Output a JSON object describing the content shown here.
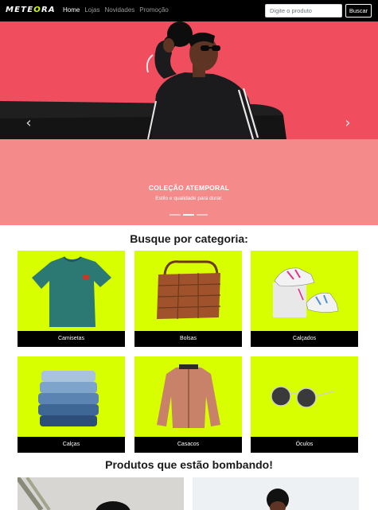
{
  "navbar": {
    "logo_text_main": "METE",
    "logo_text_accent": "O",
    "logo_text_end": "RA",
    "links": [
      {
        "label": "Home"
      },
      {
        "label": "Lojas"
      },
      {
        "label": "Novidades"
      },
      {
        "label": "Promoção"
      }
    ],
    "search_placeholder": "Digite o produto",
    "search_button": "Buscar"
  },
  "carousel": {
    "title": "COLEÇÃO ATEMPORAL",
    "text": "Estilo e qualidade para durar.",
    "prev_icon": "‹",
    "next_icon": "›",
    "active_index": 1,
    "slide_count": 3
  },
  "categories_title": "Busque por categoria:",
  "categories": [
    {
      "label": "Camisetas"
    },
    {
      "label": "Bolsas"
    },
    {
      "label": "Calçados"
    },
    {
      "label": "Calças"
    },
    {
      "label": "Casacos"
    },
    {
      "label": "Óculos"
    }
  ],
  "products_title": "Produtos que estão bombando!",
  "colors": {
    "accent": "#d8ff00",
    "hero_bg": "#f25062",
    "caption_bg": "#f48a8a",
    "nav_bg": "#000000"
  }
}
